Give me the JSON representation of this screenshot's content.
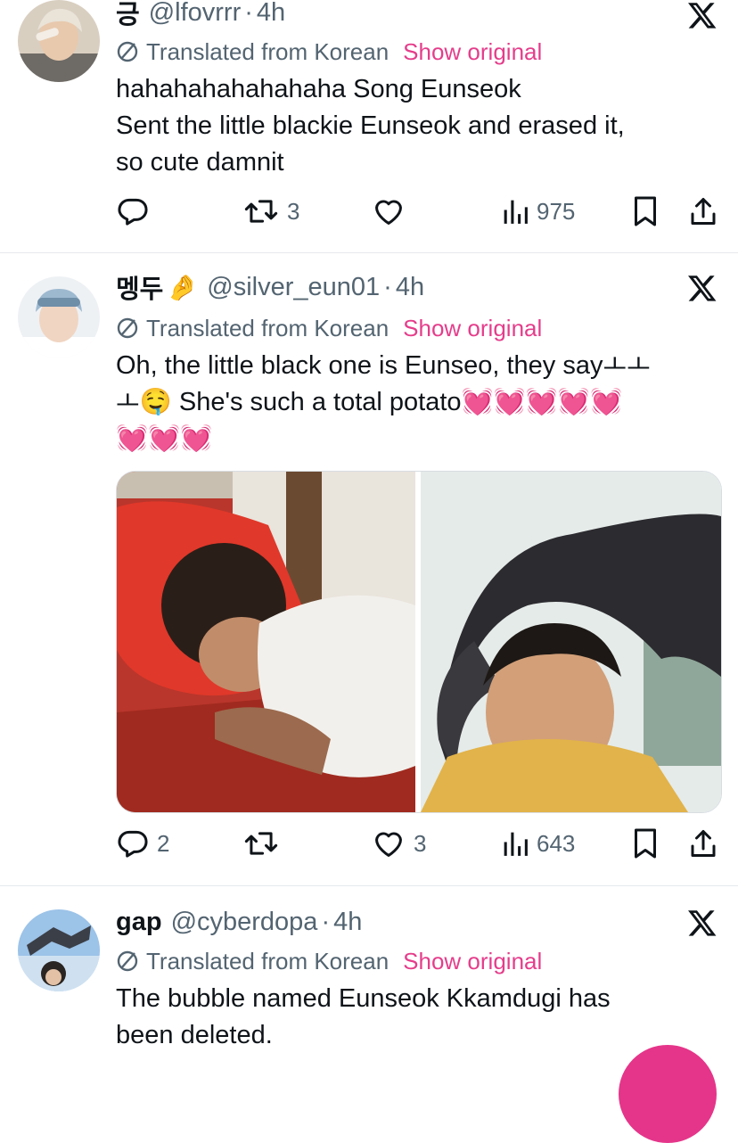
{
  "colors": {
    "accent": "#e5358a",
    "muted": "#536471",
    "text": "#0f1419"
  },
  "tweets": [
    {
      "name": "긍",
      "handle": "@lfovrrr",
      "dot": "·",
      "time": "4h",
      "translated_label": "Translated from Korean",
      "show_original": "Show original",
      "text_lines": [
        "hahahahahahahaha Song Eunseok",
        "Sent the little blackie Eunseok and erased it,",
        "so cute damnit"
      ],
      "stats": {
        "replies": "",
        "retweets": "3",
        "likes": "",
        "views": "975"
      }
    },
    {
      "name": "멩두",
      "handle": "@silver_eun01",
      "dot": "·",
      "time": "4h",
      "translated_label": "Translated from Korean",
      "show_original": "Show original",
      "text_lines": [
        "Oh, the little black one is Eunseo, they sayㅗㅗ",
        "ㅗ🤤 She's such a total potato💓💓💓💓💓",
        "💓💓💓"
      ],
      "media": [
        "child-sleeping-on-red-pillow-photo",
        "child-in-black-sun-hat-photo"
      ],
      "stats": {
        "replies": "2",
        "retweets": "",
        "likes": "3",
        "views": "643"
      }
    },
    {
      "name": "gap",
      "handle": "@cyberdopa",
      "dot": "·",
      "time": "4h",
      "translated_label": "Translated from Korean",
      "show_original": "Show original",
      "text_lines": [
        "The bubble named Eunseok Kkamdugi has",
        "been deleted."
      ]
    }
  ],
  "icons": {
    "reply": "reply-icon",
    "retweet": "retweet-icon",
    "like": "heart-icon",
    "views": "views-icon",
    "bookmark": "bookmark-icon",
    "share": "share-icon",
    "translate": "translate-icon",
    "platform": "x-logo-icon",
    "compose": "compose-fab-icon"
  }
}
